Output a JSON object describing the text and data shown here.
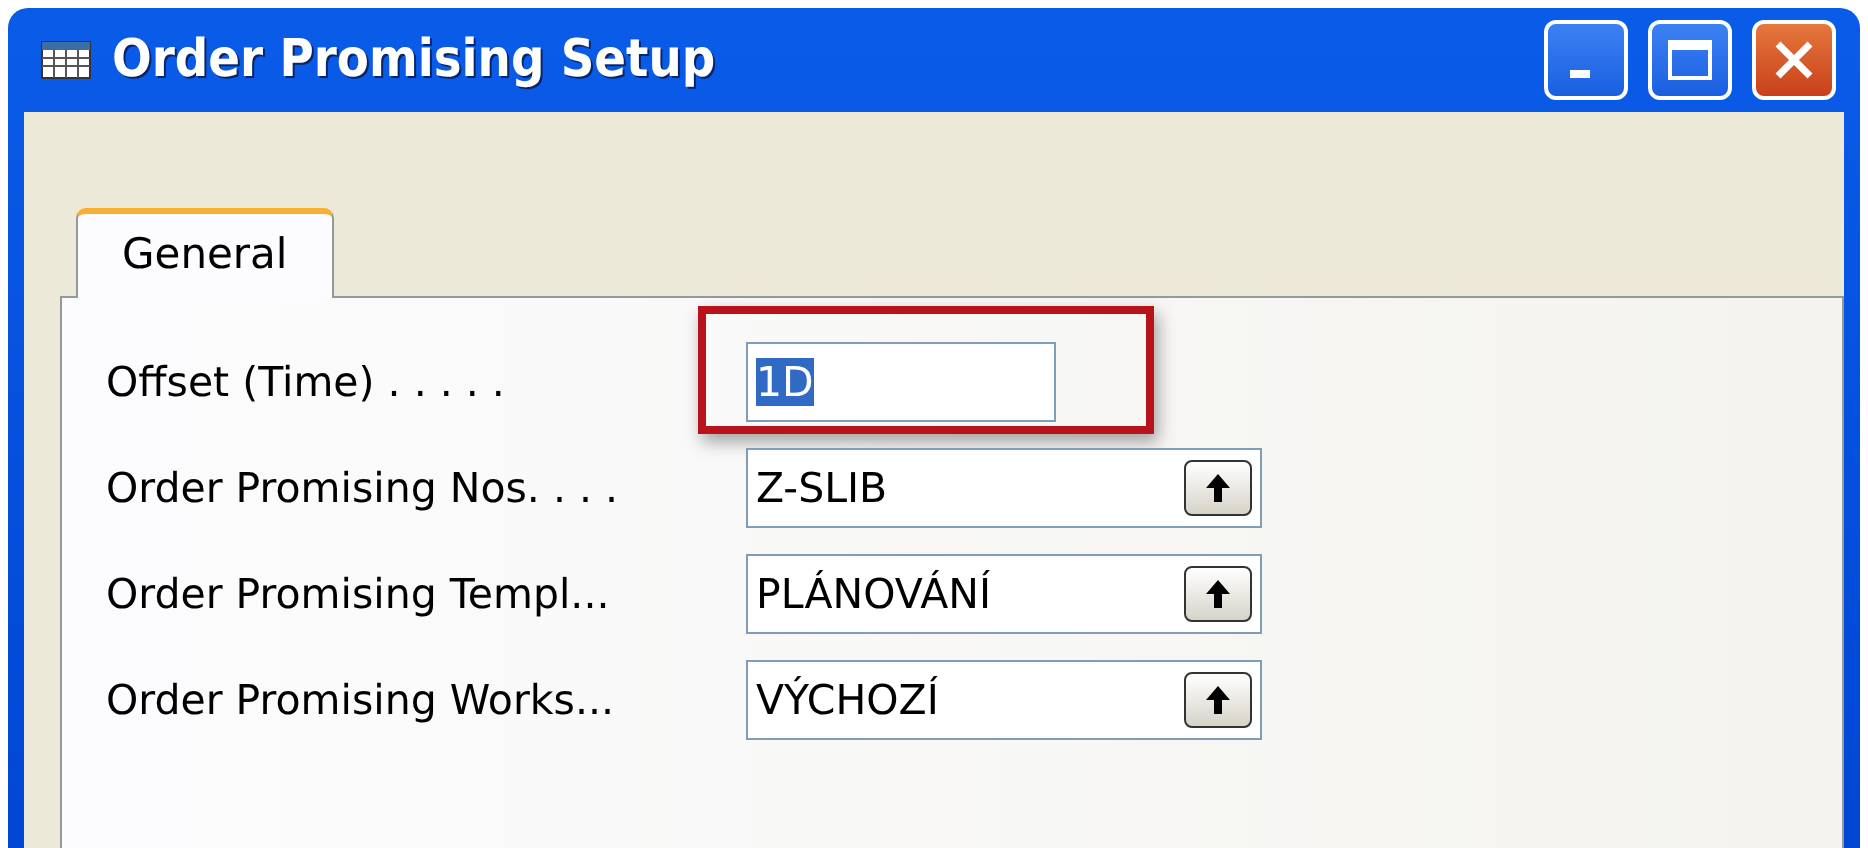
{
  "window": {
    "title": "Order Promising Setup"
  },
  "tabs": [
    {
      "label": "General",
      "selected": true
    }
  ],
  "fields": [
    {
      "kind": "text",
      "label": "Offset (Time) . . . . .",
      "value": "1D",
      "text_selected": true,
      "highlighted": true
    },
    {
      "kind": "lookup",
      "label": "Order Promising Nos. . . .",
      "value": "Z-SLIB",
      "text_selected": false,
      "highlighted": false
    },
    {
      "kind": "lookup",
      "label": "Order Promising Templ...",
      "value": "PLÁNOVÁNÍ",
      "text_selected": false,
      "highlighted": false
    },
    {
      "kind": "lookup",
      "label": "Order Promising Works...",
      "value": "VÝCHOZÍ",
      "text_selected": false,
      "highlighted": false
    }
  ]
}
